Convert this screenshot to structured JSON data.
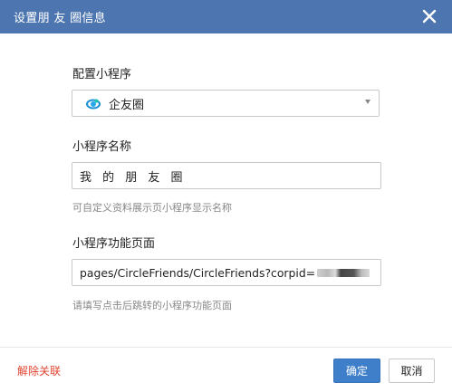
{
  "dialog": {
    "title": "设置朋 友 圈信息",
    "close_icon": "close-icon"
  },
  "app_field": {
    "label": "配置小程序",
    "selected_value": "企友圈",
    "app_icon": "circle-friends-app-icon"
  },
  "name_field": {
    "label": "小程序名称",
    "value": "我 的 朋 友 圈",
    "hint": "可自定义资料展示页小程序显示名称"
  },
  "page_field": {
    "label": "小程序功能页面",
    "value": "pages/CircleFriends/CircleFriends?corpid=",
    "hint": "请填写点击后跳转的小程序功能页面"
  },
  "footer": {
    "unlink_label": "解除关联",
    "confirm_label": "确定",
    "cancel_label": "取消"
  },
  "colors": {
    "header_bg": "#4d76b1",
    "primary_button": "#3f7fc9",
    "danger_link": "#e0432f"
  }
}
